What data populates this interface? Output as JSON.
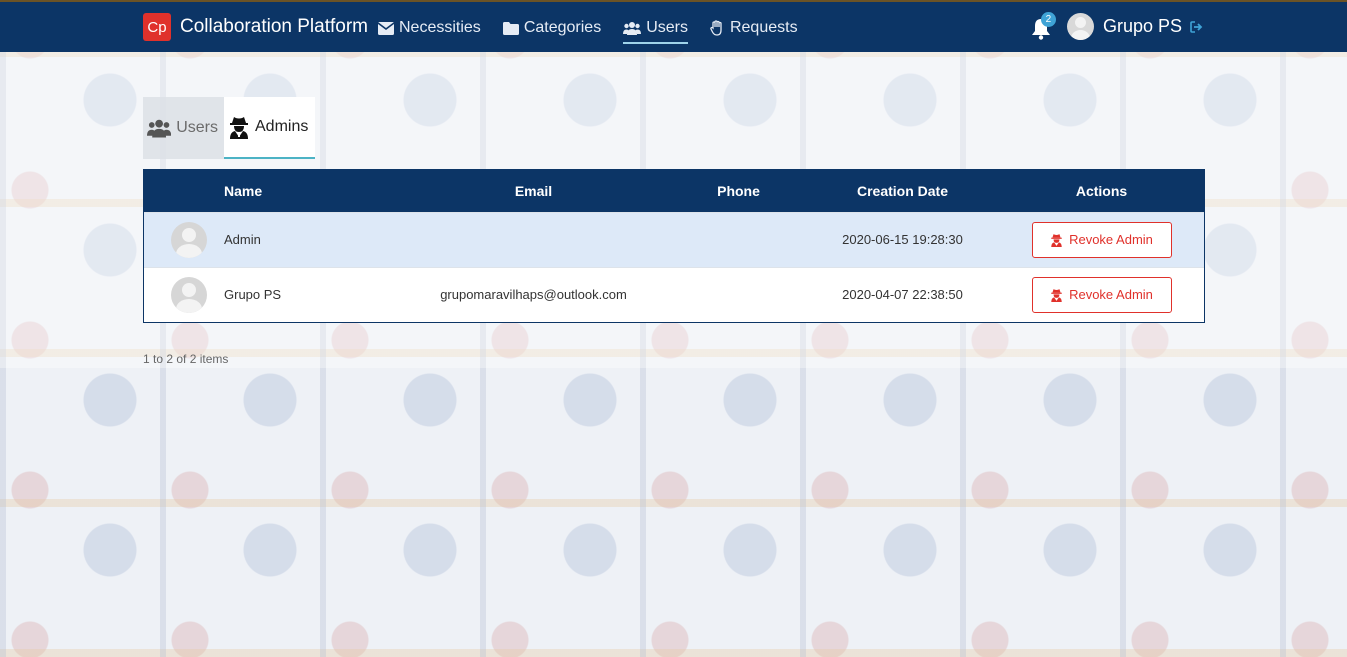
{
  "navbar": {
    "logo": "Cp",
    "brand": "Collaboration Platform",
    "items": [
      {
        "label": "Necessities",
        "icon": "envelope-icon"
      },
      {
        "label": "Categories",
        "icon": "folder-icon"
      },
      {
        "label": "Users",
        "icon": "users-icon",
        "active": true
      },
      {
        "label": "Requests",
        "icon": "hand-icon"
      }
    ],
    "notifications": "2",
    "user": "Grupo PS"
  },
  "tabs": {
    "users": "Users",
    "admins": "Admins"
  },
  "table": {
    "columns": [
      "Name",
      "Email",
      "Phone",
      "Creation Date",
      "Actions"
    ],
    "rows": [
      {
        "name": "Admin",
        "email": "",
        "phone": "",
        "created": "2020-06-15 19:28:30",
        "action": "Revoke Admin"
      },
      {
        "name": "Grupo PS",
        "email": "grupomaravilhaps@outlook.com",
        "phone": "",
        "created": "2020-04-07 22:38:50",
        "action": "Revoke Admin"
      }
    ]
  },
  "pager": "1 to 2 of 2 items",
  "colors": {
    "navbar": "#0c3566",
    "accent": "#e0312b",
    "active_underline": "#9fd3ea"
  }
}
